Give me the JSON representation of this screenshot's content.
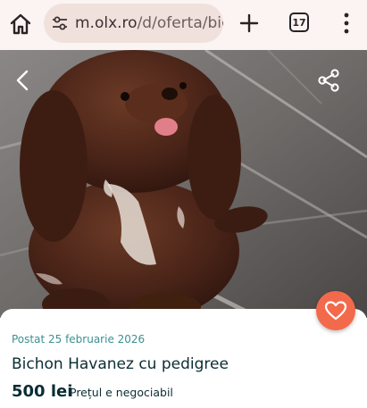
{
  "browser": {
    "url_host": "m.olx.ro",
    "url_path": "/d/oferta/bić",
    "tab_count": "17",
    "icons": [
      "home-icon",
      "site-settings-icon",
      "new-tab-icon",
      "tab-switcher-icon",
      "more-menu-icon"
    ]
  },
  "listing": {
    "posted": "Postat 25 februarie 2026",
    "title": "Bichon Havanez cu pedigree",
    "price": "500 lei",
    "negotiable": "Prețul e negociabil"
  },
  "image_controls": {
    "icons": [
      "back-arrow-icon",
      "share-icon",
      "heart-icon"
    ]
  },
  "colors": {
    "accent": "#f26a4b",
    "posted_text": "#3d8f92",
    "heading_text": "#0a2d33",
    "chrome_bg": "#fbf4f2",
    "urlbar_bg": "#f1e1dd"
  }
}
